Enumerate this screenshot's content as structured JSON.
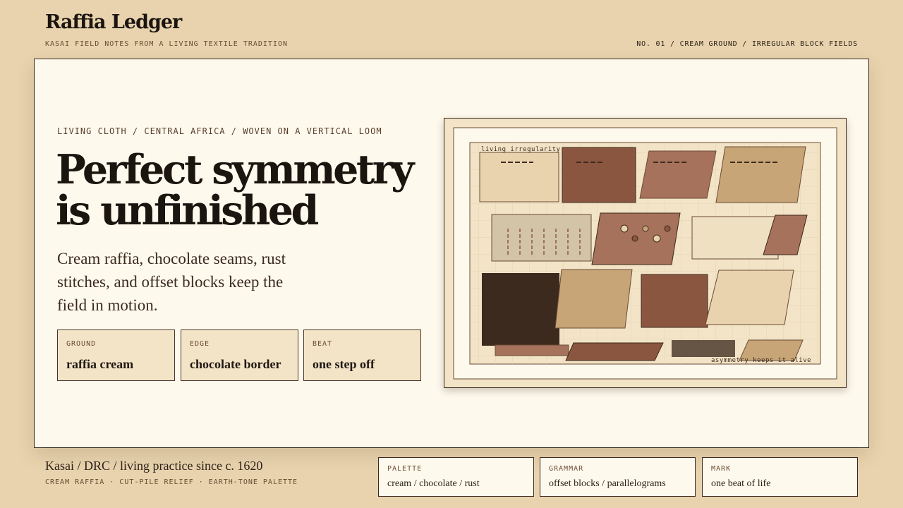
{
  "header": {
    "title": "Raffia Ledger",
    "subtitle": "KASAI FIELD NOTES FROM A LIVING TEXTILE TRADITION",
    "issue": "NO. 01 / CREAM GROUND / IRREGULAR BLOCK FIELDS"
  },
  "hero": {
    "kicker": "LIVING CLOTH / CENTRAL AFRICA / WOVEN ON A VERTICAL LOOM",
    "headline_line1": "Perfect symmetry",
    "headline_line2": "is unfinished",
    "lede": "Cream raffia, chocolate seams, rust stitches, and offset blocks keep the field in motion.",
    "chips": [
      {
        "key": "GROUND",
        "value": "raffia cream"
      },
      {
        "key": "EDGE",
        "value": "chocolate border"
      },
      {
        "key": "BEAT",
        "value": "one step off"
      }
    ]
  },
  "figure": {
    "label_top": "living irregularity",
    "label_bottom": "asymmetry keeps it alive",
    "colors": {
      "cream": "#e8d3ae",
      "chocolate": "#3d2a1e",
      "rust": "#8b5640",
      "clay": "#a6725b",
      "tan": "#c7a577",
      "stone": "#d3c4a8",
      "umber": "#665545"
    }
  },
  "footer": {
    "origin": "Kasai / DRC / living practice since c. 1620",
    "origin_sub": "CREAM RAFFIA · CUT-PILE RELIEF · EARTH-TONE PALETTE",
    "meta": [
      {
        "key": "PALETTE",
        "value": "cream / chocolate / rust"
      },
      {
        "key": "GRAMMAR",
        "value": "offset blocks / parallelograms"
      },
      {
        "key": "MARK",
        "value": "one beat of life"
      }
    ]
  }
}
